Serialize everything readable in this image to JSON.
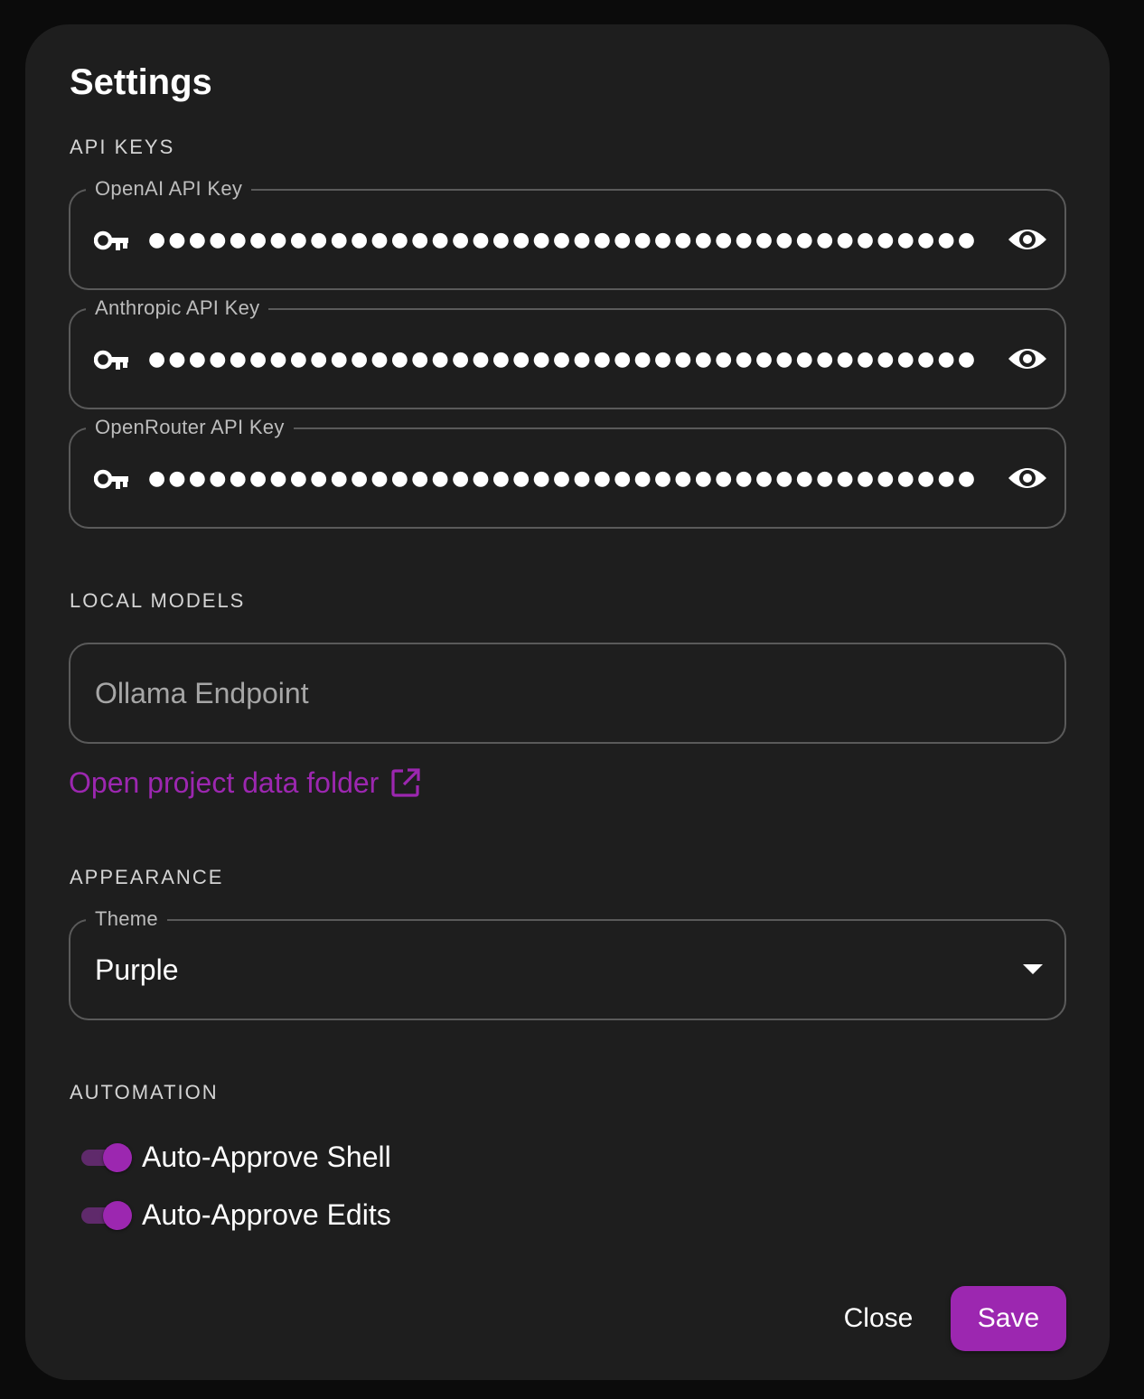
{
  "dialog": {
    "title": "Settings"
  },
  "api_keys": {
    "section_label": "API KEYS",
    "fields": [
      {
        "label": "OpenAI API Key",
        "masked_value": "●●●●●●●●●●●●●●●●●●●●●●●●●●●●●●●●●●●●●●●●●●●●●●●●●●",
        "key_icon": "key-icon",
        "toggle_icon": "eye-icon"
      },
      {
        "label": "Anthropic API Key",
        "masked_value": "●●●●●●●●●●●●●●●●●●●●●●●●●●●●●●●●●●●●●●●●●●●●●●●●●●",
        "key_icon": "key-icon",
        "toggle_icon": "eye-icon"
      },
      {
        "label": "OpenRouter API Key",
        "masked_value": "●●●●●●●●●●●●●●●●●●●●●●●●●●●●●●●●●●●●●●●●●●●●●●●●●●",
        "key_icon": "key-icon",
        "toggle_icon": "eye-icon"
      }
    ]
  },
  "local_models": {
    "section_label": "LOCAL MODELS",
    "ollama_placeholder": "Ollama Endpoint",
    "open_folder_link": "Open project data folder",
    "open_folder_icon": "external-link-icon"
  },
  "appearance": {
    "section_label": "APPEARANCE",
    "theme_label": "Theme",
    "theme_value": "Purple"
  },
  "automation": {
    "section_label": "AUTOMATION",
    "toggles": [
      {
        "label": "Auto-Approve Shell",
        "on": true
      },
      {
        "label": "Auto-Approve Edits",
        "on": true
      }
    ]
  },
  "actions": {
    "close_label": "Close",
    "save_label": "Save"
  },
  "colors": {
    "accent": "#9c27b0",
    "dialog_background": "#1e1e1e",
    "page_background": "#0b0b0b",
    "border": "#5a5a5a"
  }
}
